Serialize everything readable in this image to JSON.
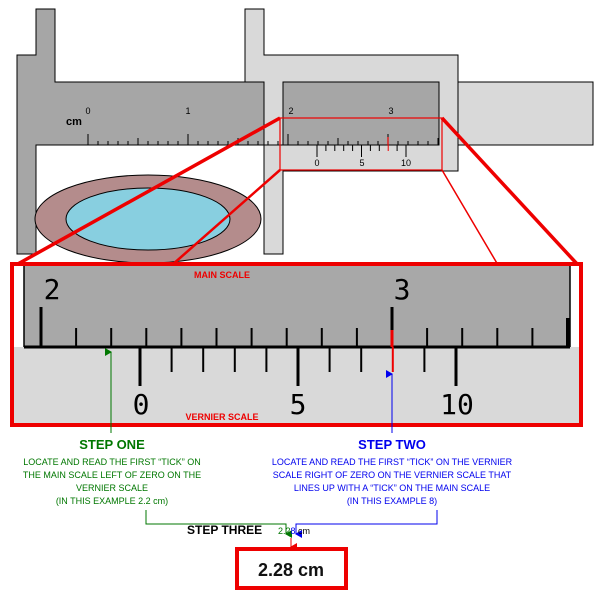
{
  "colors": {
    "step_one": "#007700",
    "step_two": "#0000ee",
    "highlight": "#ee0000",
    "fixed_jaw": "#a6a6a6",
    "slider": "#d9d9d9",
    "ring": "#b48c8c",
    "object": "#88cfe0"
  },
  "caliper": {
    "unit_label": "cm",
    "main_labels": [
      "0",
      "1",
      "2",
      "3"
    ],
    "vernier_labels": [
      "0",
      "5",
      "10"
    ]
  },
  "zoom_view": {
    "main_scale_title": "MAIN SCALE",
    "vernier_scale_title": "VERNIER SCALE",
    "main_labels": [
      "2",
      "3"
    ],
    "vernier_labels": [
      "0",
      "5",
      "10"
    ]
  },
  "step_one": {
    "title": "STEP ONE",
    "lines": [
      "LOCATE AND READ THE FIRST “TICK” ON",
      "THE MAIN SCALE LEFT OF ZERO ON THE",
      "VERNIER SCALE",
      "(IN THIS EXAMPLE  2.2 cm)"
    ]
  },
  "step_two": {
    "title": "STEP TWO",
    "lines": [
      "LOCATE AND READ THE FIRST “TICK” ON THE VERNIER",
      "SCALE RIGHT OF ZERO ON THE VERNIER SCALE THAT",
      "LINES UP WITH A “TICK” ON THE MAIN SCALE",
      "(IN THIS EXAMPLE   8)"
    ]
  },
  "step_three": {
    "title": "STEP THREE",
    "part_main": "2.2",
    "part_vernier": "8",
    "unit": " cm"
  },
  "result": "2.28 cm"
}
